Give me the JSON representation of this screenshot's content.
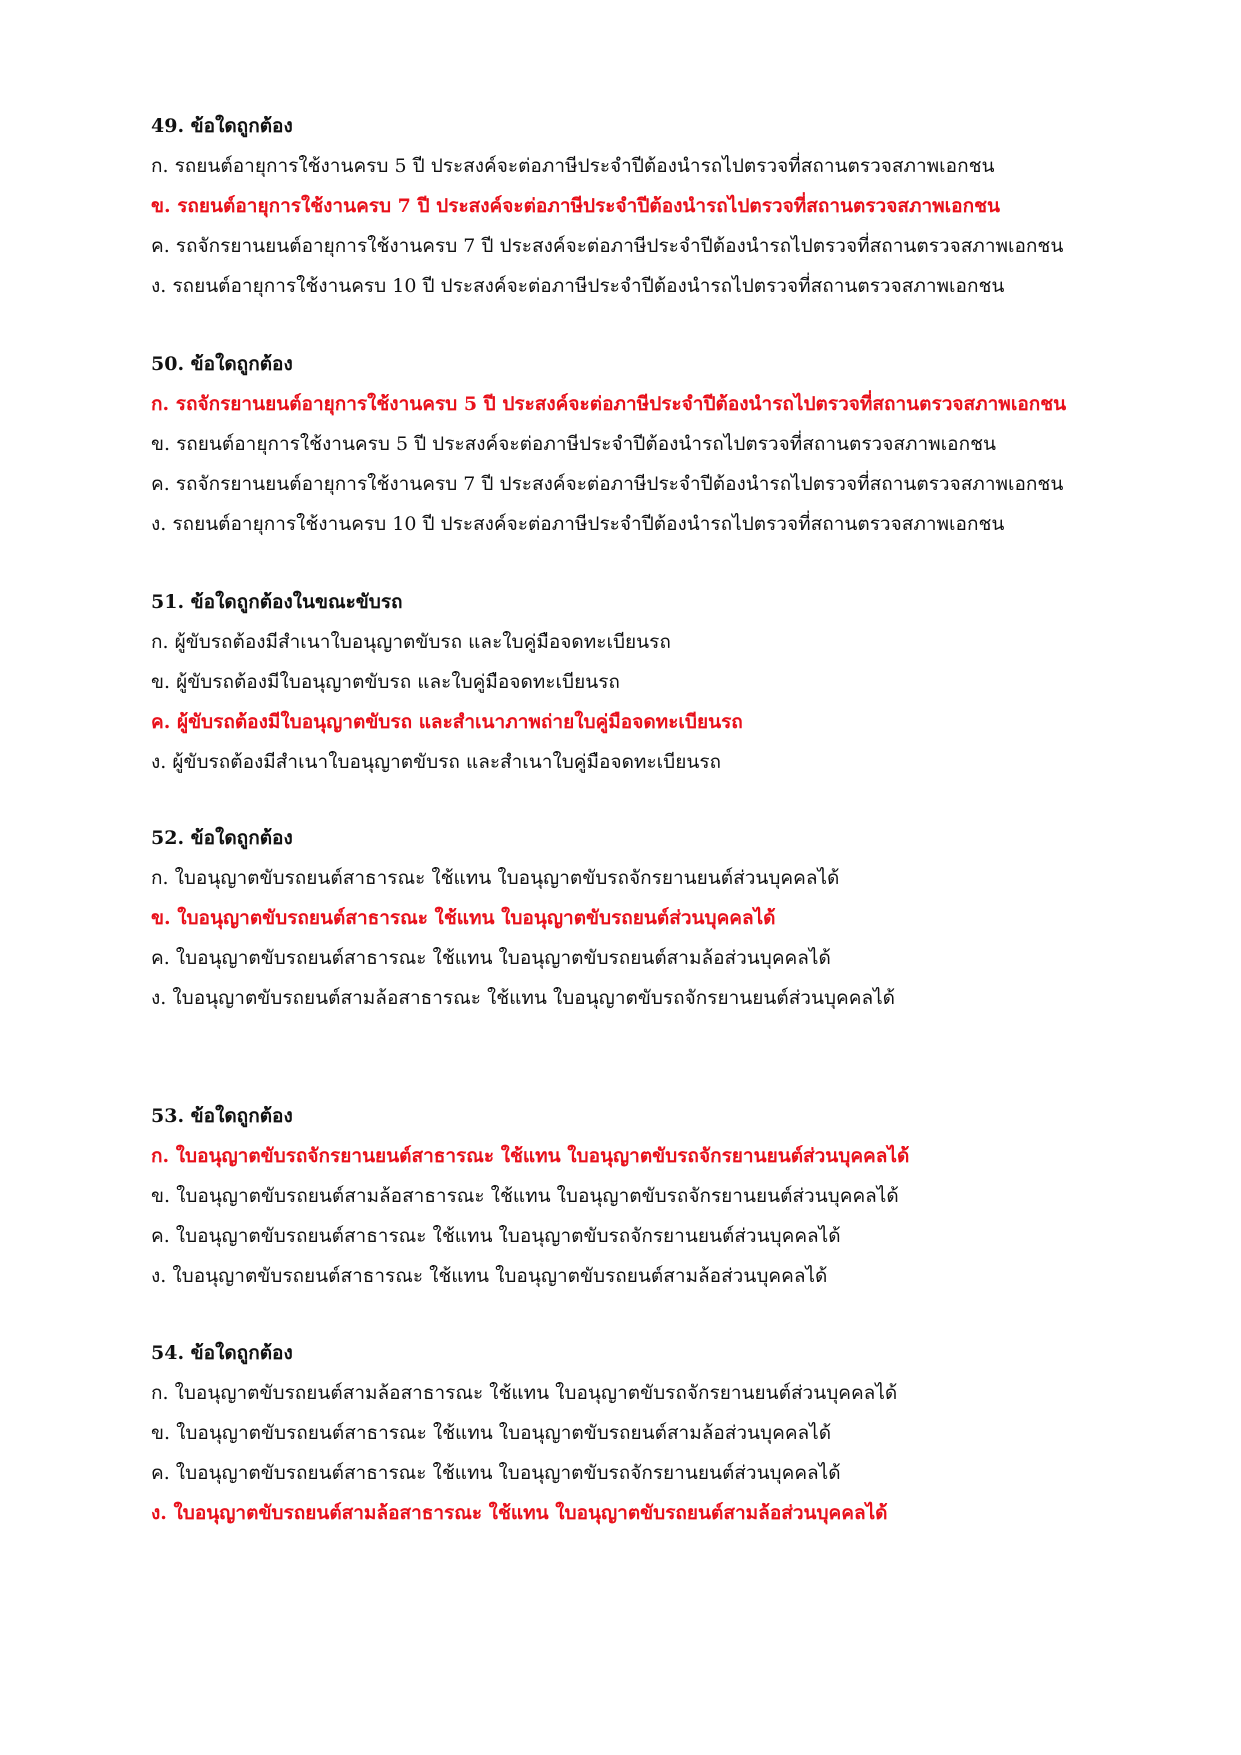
{
  "colors": {
    "text": "#111111",
    "correct_answer": "#e8101a"
  },
  "questions": [
    {
      "title": "49. ข้อใดถูกต้อง",
      "options": [
        {
          "text": "ก. รถยนต์อายุการใช้งานครบ 5 ปี ประสงค์จะต่อภาษีประจำปีต้องนำรถไปตรวจที่สถานตรวจสภาพเอกชน",
          "correct": false
        },
        {
          "text": "ข. รถยนต์อายุการใช้งานครบ 7 ปี ประสงค์จะต่อภาษีประจำปีต้องนำรถไปตรวจที่สถานตรวจสภาพเอกชน",
          "correct": true
        },
        {
          "text": "ค. รถจักรยานยนต์อายุการใช้งานครบ 7 ปี ประสงค์จะต่อภาษีประจำปีต้องนำรถไปตรวจที่สถานตรวจสภาพเอกชน",
          "correct": false
        },
        {
          "text": "ง. รถยนต์อายุการใช้งานครบ 10 ปี ประสงค์จะต่อภาษีประจำปีต้องนำรถไปตรวจที่สถานตรวจสภาพเอกชน",
          "correct": false
        }
      ]
    },
    {
      "title": "50. ข้อใดถูกต้อง",
      "options": [
        {
          "text": "ก. รถจักรยานยนต์อายุการใช้งานครบ 5 ปี ประสงค์จะต่อภาษีประจำปีต้องนำรถไปตรวจที่สถานตรวจสภาพเอกชน",
          "correct": true
        },
        {
          "text": "ข. รถยนต์อายุการใช้งานครบ 5 ปี ประสงค์จะต่อภาษีประจำปีต้องนำรถไปตรวจที่สถานตรวจสภาพเอกชน",
          "correct": false
        },
        {
          "text": "ค. รถจักรยานยนต์อายุการใช้งานครบ 7 ปี ประสงค์จะต่อภาษีประจำปีต้องนำรถไปตรวจที่สถานตรวจสภาพเอกชน",
          "correct": false
        },
        {
          "text": "ง. รถยนต์อายุการใช้งานครบ 10 ปี ประสงค์จะต่อภาษีประจำปีต้องนำรถไปตรวจที่สถานตรวจสภาพเอกชน",
          "correct": false
        }
      ]
    },
    {
      "title": "51. ข้อใดถูกต้องในขณะขับรถ",
      "options": [
        {
          "text": "ก. ผู้ขับรถต้องมีสำเนาใบอนุญาตขับรถ และใบคู่มือจดทะเบียนรถ",
          "correct": false
        },
        {
          "text": "ข. ผู้ขับรถต้องมีใบอนุญาตขับรถ และใบคู่มือจดทะเบียนรถ",
          "correct": false
        },
        {
          "text": "ค. ผู้ขับรถต้องมีใบอนุญาตขับรถ และสำเนาภาพถ่ายใบคู่มือจดทะเบียนรถ",
          "correct": true
        },
        {
          "text": "ง. ผู้ขับรถต้องมีสำเนาใบอนุญาตขับรถ และสำเนาใบคู่มือจดทะเบียนรถ",
          "correct": false
        }
      ]
    },
    {
      "title": "52. ข้อใดถูกต้อง",
      "options": [
        {
          "text": "ก. ใบอนุญาตขับรถยนต์สาธารณะ ใช้แทน ใบอนุญาตขับรถจักรยานยนต์ส่วนบุคคลได้",
          "correct": false
        },
        {
          "text": "ข. ใบอนุญาตขับรถยนต์สาธารณะ ใช้แทน ใบอนุญาตขับรถยนต์ส่วนบุคคลได้",
          "correct": true
        },
        {
          "text": "ค. ใบอนุญาตขับรถยนต์สาธารณะ ใช้แทน ใบอนุญาตขับรถยนต์สามล้อส่วนบุคคลได้",
          "correct": false
        },
        {
          "text": "ง. ใบอนุญาตขับรถยนต์สามล้อสาธารณะ ใช้แทน ใบอนุญาตขับรถจักรยานยนต์ส่วนบุคคลได้",
          "correct": false
        }
      ]
    },
    {
      "title": "53. ข้อใดถูกต้อง",
      "options": [
        {
          "text": "ก. ใบอนุญาตขับรถจักรยานยนต์สาธารณะ ใช้แทน ใบอนุญาตขับรถจักรยานยนต์ส่วนบุคคลได้",
          "correct": true
        },
        {
          "text": "ข. ใบอนุญาตขับรถยนต์สามล้อสาธารณะ ใช้แทน ใบอนุญาตขับรถจักรยานยนต์ส่วนบุคคลได้",
          "correct": false
        },
        {
          "text": "ค. ใบอนุญาตขับรถยนต์สาธารณะ ใช้แทน ใบอนุญาตขับรถจักรยานยนต์ส่วนบุคคลได้",
          "correct": false
        },
        {
          "text": "ง. ใบอนุญาตขับรถยนต์สาธารณะ ใช้แทน ใบอนุญาตขับรถยนต์สามล้อส่วนบุคคลได้",
          "correct": false
        }
      ]
    },
    {
      "title": "54. ข้อใดถูกต้อง",
      "options": [
        {
          "text": "ก. ใบอนุญาตขับรถยนต์สามล้อสาธารณะ ใช้แทน ใบอนุญาตขับรถจักรยานยนต์ส่วนบุคคลได้",
          "correct": false
        },
        {
          "text": "ข. ใบอนุญาตขับรถยนต์สาธารณะ ใช้แทน ใบอนุญาตขับรถยนต์สามล้อส่วนบุคคลได้",
          "correct": false
        },
        {
          "text": "ค. ใบอนุญาตขับรถยนต์สาธารณะ ใช้แทน ใบอนุญาตขับรถจักรยานยนต์ส่วนบุคคลได้",
          "correct": false
        },
        {
          "text": "ง. ใบอนุญาตขับรถยนต์สามล้อสาธารณะ ใช้แทน ใบอนุญาตขับรถยนต์สามล้อส่วนบุคคลได้",
          "correct": true
        }
      ]
    }
  ]
}
